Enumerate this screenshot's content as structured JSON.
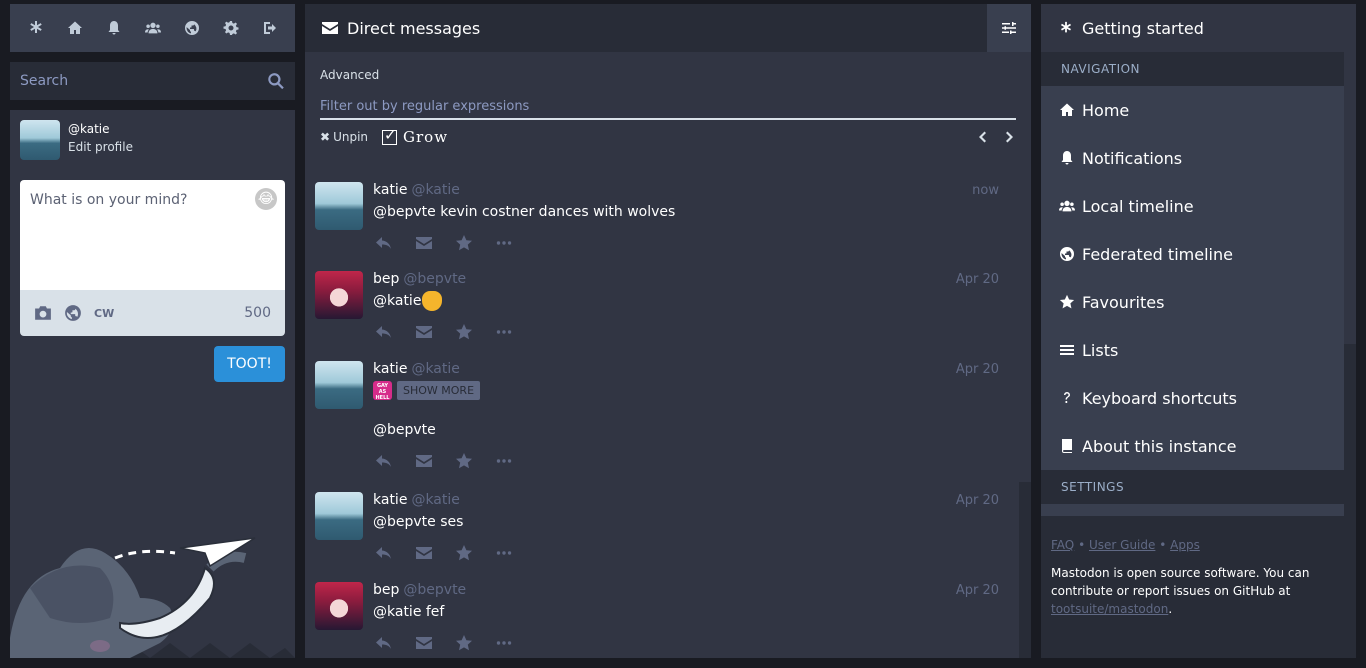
{
  "nav": {
    "icons": [
      "getting-started-icon",
      "home-icon",
      "notifications-icon",
      "local-timeline-icon",
      "federated-timeline-icon",
      "settings-icon",
      "logout-icon"
    ]
  },
  "search": {
    "placeholder": "Search"
  },
  "account": {
    "handle": "@katie",
    "edit_profile": "Edit profile"
  },
  "compose": {
    "placeholder": "What is on your mind?",
    "cw_label": "CW",
    "char_count": "500",
    "submit_label": "TOOT!"
  },
  "column": {
    "title": "Direct messages",
    "advanced_label": "Advanced",
    "regex_placeholder": "Filter out by regular expressions",
    "unpin_label": "Unpin",
    "grow_label": "Grow"
  },
  "statuses": [
    {
      "name": "katie",
      "acct": "@katie",
      "time": "now",
      "content": "@bepvte kevin costner dances with wolves"
    },
    {
      "name": "bep",
      "acct": "@bepvte",
      "time": "Apr 20",
      "content": "@katie"
    },
    {
      "name": "katie",
      "acct": "@katie",
      "time": "Apr 20",
      "cw_emoji_text": "GAY AS HELL",
      "show_more": "SHOW MORE",
      "content": "@bepvte"
    },
    {
      "name": "katie",
      "acct": "@katie",
      "time": "Apr 20",
      "content": "@bepvte ses"
    },
    {
      "name": "bep",
      "acct": "@bepvte",
      "time": "Apr 20",
      "content": "@katie fef"
    }
  ],
  "getting_started": {
    "title": "Getting started",
    "navigation_title": "NAVIGATION",
    "items": [
      {
        "label": "Home",
        "icon": "home-icon"
      },
      {
        "label": "Notifications",
        "icon": "bell-icon"
      },
      {
        "label": "Local timeline",
        "icon": "users-icon"
      },
      {
        "label": "Federated timeline",
        "icon": "globe-icon"
      },
      {
        "label": "Favourites",
        "icon": "star-icon"
      },
      {
        "label": "Lists",
        "icon": "list-icon"
      },
      {
        "label": "Keyboard shortcuts",
        "icon": "question-icon"
      },
      {
        "label": "About this instance",
        "icon": "book-icon"
      }
    ],
    "settings_title": "SETTINGS"
  },
  "footer": {
    "faq": "FAQ",
    "user_guide": "User Guide",
    "apps": "Apps",
    "sep": "•",
    "about_text": "Mastodon is open source software. You can contribute or report issues on GitHub at",
    "repo": "tootsuite/mastodon",
    "period": "."
  },
  "colors": {
    "background": "#191b22",
    "panel": "#282c37",
    "column": "#313543",
    "nav_item": "#393f4f",
    "accent": "#2b90d9",
    "muted": "#606984"
  }
}
